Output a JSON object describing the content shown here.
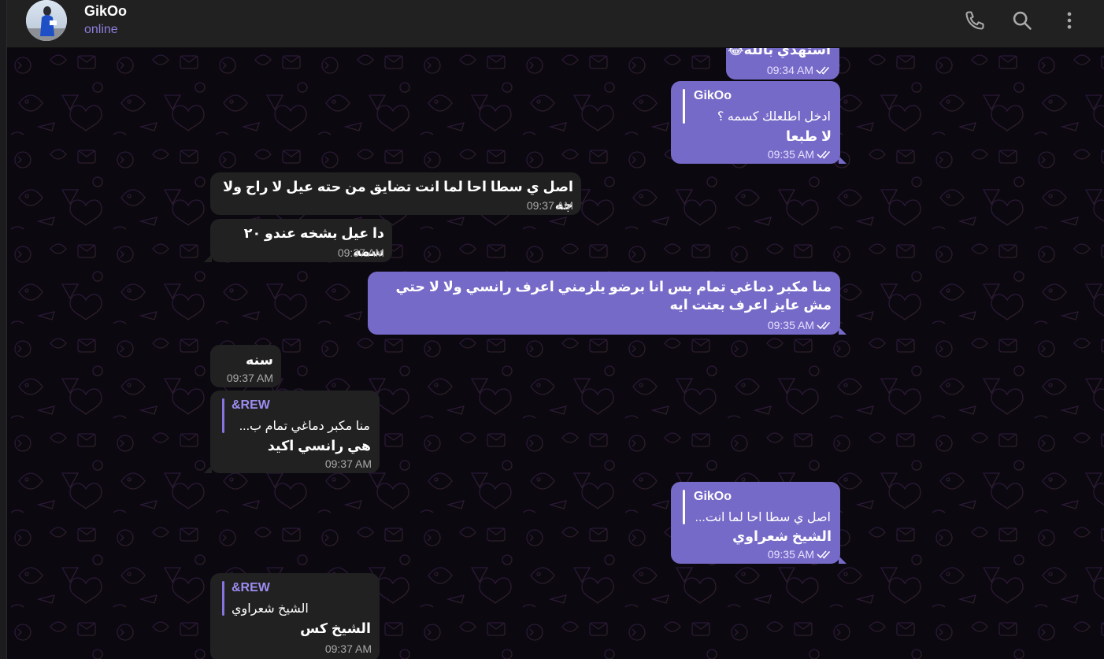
{
  "header": {
    "name": "GikOo",
    "status": "online"
  },
  "icons": {
    "call": "phone-icon",
    "search": "search-icon",
    "menu": "more-vertical-icon"
  },
  "colors": {
    "outgoing_bubble": "#766ac8",
    "incoming_bubble": "#212121",
    "accent": "#8774e1"
  },
  "messages": [
    {
      "dir": "out",
      "text": "استهدي بالله😂",
      "time": "09:34 AM"
    },
    {
      "dir": "out",
      "reply_name": "GikOo",
      "reply_text": "ادخل اطلعلك كسمه ؟",
      "text": "لا طبعا",
      "time": "09:35 AM"
    },
    {
      "dir": "in",
      "text": "اصل ي سطا احا لما انت تضايق من حته عيل لا راح ولا جه",
      "time": "09:37 AM"
    },
    {
      "dir": "in",
      "text": "دا عيل بشخه عندو ٢٠ سمه",
      "time": "09:37 AM"
    },
    {
      "dir": "out",
      "text": "منا مكبر دماغي تمام بس انا برضو يلزمني اعرف رانسي ولا لا حتي مش عايز اعرف بعتت ايه",
      "time": "09:35 AM"
    },
    {
      "dir": "in",
      "text": "سنه",
      "time": "09:37 AM"
    },
    {
      "dir": "in",
      "reply_name": "&REW",
      "reply_text": "منا مكبر دماغي تمام ب...",
      "text": "هي رانسي اكيد",
      "time": "09:37 AM"
    },
    {
      "dir": "out",
      "reply_name": "GikOo",
      "reply_text": "اصل ي سطا احا لما انت...",
      "text": "الشيخ شعراوي",
      "time": "09:35 AM"
    },
    {
      "dir": "in",
      "reply_name": "&REW",
      "reply_text": "الشيخ شعراوي",
      "text": "الشيخ كس",
      "time": "09:37 AM"
    }
  ]
}
